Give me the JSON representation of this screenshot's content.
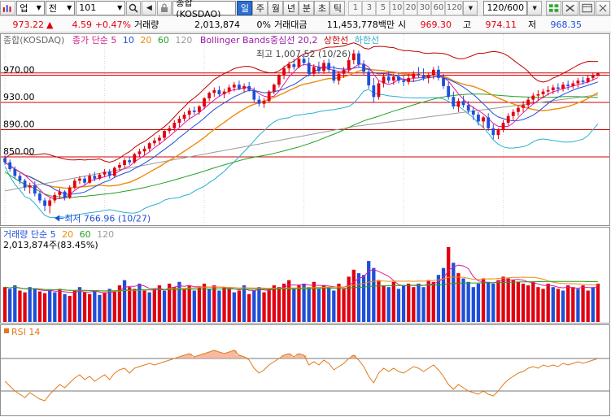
{
  "toolbar": {
    "market": "업",
    "stock_type": "전",
    "code": "101",
    "name": "종합(KOSDAQ)",
    "periods": [
      "일",
      "주",
      "월",
      "년",
      "분",
      "초",
      "틱"
    ],
    "active_period": "일",
    "intervals": [
      "1",
      "3",
      "5",
      "10",
      "20",
      "30",
      "60",
      "120"
    ],
    "count": "120/600"
  },
  "quote": {
    "price": "973.22",
    "arrow": "▲",
    "change": "4.59",
    "change_pct": "+0.47%",
    "volume_label": "거래량",
    "volume": "2,013,874",
    "volume_pct": "0%",
    "amount_label": "거래대금",
    "amount": "11,453,778백만",
    "open_label": "시",
    "open": "969.30",
    "high_label": "고",
    "high": "974.11",
    "low_label": "저",
    "low": "968.35"
  },
  "legend": {
    "name": "종합(KOSDAQ)",
    "ma_label": "종가 단순 5",
    "ma_periods": [
      "10",
      "20",
      "60",
      "120"
    ],
    "bb_label": "Bollinger Bands중심선 20,2",
    "bb_upper": "상한선",
    "bb_lower": "하한선",
    "volume_label": "거래량 단순 5",
    "volume_periods": [
      "20",
      "60",
      "120"
    ],
    "volume_value": "2,013,874주(83.45%)",
    "rsi_label": "RSI 14"
  },
  "colors": {
    "up": "#e0000f",
    "down": "#1f4fd8",
    "ma5": "#e01a9a",
    "ma10": "#1e4fd8",
    "ma20": "#f08a0a",
    "ma60": "#22a022",
    "ma120": "#9a9a9a",
    "bb_upper": "#c00000",
    "bb_lower": "#29b0d0",
    "rsi": "#e07a1a",
    "hline": "#d00000"
  },
  "chart_data": {
    "type": "candlestick",
    "ylim": [
      752,
      1010
    ],
    "y_ticks": [
      "970.00",
      "930.00",
      "890.00",
      "850.00"
    ],
    "y_tick_values": [
      970,
      930,
      890,
      850
    ],
    "hlines": [
      970,
      930,
      890,
      850
    ],
    "annotations": {
      "high": "최고 1,007.52 (10/26)",
      "low": "최저 766.96 (10/27)",
      "high_value": 1007.52,
      "low_value": 766.96
    },
    "candles": [
      [
        848,
        852,
        838,
        842
      ],
      [
        842,
        846,
        828,
        832
      ],
      [
        832,
        836,
        818,
        822
      ],
      [
        822,
        826,
        810,
        815
      ],
      [
        815,
        818,
        800,
        805
      ],
      [
        805,
        812,
        796,
        808
      ],
      [
        808,
        814,
        792,
        796
      ],
      [
        796,
        800,
        782,
        786
      ],
      [
        786,
        790,
        770,
        778
      ],
      [
        778,
        790,
        766.96,
        786
      ],
      [
        786,
        798,
        782,
        794
      ],
      [
        794,
        804,
        788,
        799
      ],
      [
        799,
        801,
        786,
        790
      ],
      [
        790,
        808,
        788,
        805
      ],
      [
        805,
        818,
        802,
        815
      ],
      [
        815,
        822,
        810,
        818
      ],
      [
        818,
        822,
        808,
        812
      ],
      [
        812,
        826,
        810,
        822
      ],
      [
        822,
        828,
        814,
        818
      ],
      [
        818,
        826,
        816,
        824
      ],
      [
        824,
        832,
        820,
        828
      ],
      [
        828,
        832,
        818,
        822
      ],
      [
        822,
        836,
        820,
        834
      ],
      [
        834,
        842,
        830,
        838
      ],
      [
        838,
        848,
        834,
        845
      ],
      [
        845,
        850,
        838,
        842
      ],
      [
        842,
        856,
        840,
        854
      ],
      [
        854,
        862,
        850,
        858
      ],
      [
        858,
        866,
        852,
        862
      ],
      [
        862,
        872,
        858,
        870
      ],
      [
        870,
        878,
        866,
        874
      ],
      [
        874,
        882,
        868,
        878
      ],
      [
        878,
        890,
        874,
        888
      ],
      [
        888,
        896,
        884,
        892
      ],
      [
        892,
        904,
        888,
        900
      ],
      [
        900,
        910,
        894,
        906
      ],
      [
        906,
        916,
        902,
        912
      ],
      [
        912,
        922,
        906,
        918
      ],
      [
        918,
        924,
        912,
        916
      ],
      [
        916,
        926,
        912,
        924
      ],
      [
        924,
        938,
        920,
        936
      ],
      [
        936,
        946,
        932,
        944
      ],
      [
        944,
        952,
        938,
        948
      ],
      [
        948,
        954,
        938,
        942
      ],
      [
        942,
        950,
        936,
        946
      ],
      [
        946,
        956,
        942,
        952
      ],
      [
        952,
        960,
        946,
        956
      ],
      [
        956,
        962,
        948,
        950
      ],
      [
        950,
        958,
        944,
        954
      ],
      [
        954,
        960,
        946,
        948
      ],
      [
        948,
        952,
        930,
        934
      ],
      [
        934,
        940,
        924,
        928
      ],
      [
        928,
        936,
        922,
        932
      ],
      [
        932,
        948,
        930,
        946
      ],
      [
        946,
        958,
        942,
        956
      ],
      [
        956,
        972,
        952,
        970
      ],
      [
        970,
        984,
        964,
        980
      ],
      [
        980,
        990,
        974,
        986
      ],
      [
        986,
        994,
        978,
        982
      ],
      [
        982,
        998,
        980,
        994
      ],
      [
        994,
        1000,
        984,
        988
      ],
      [
        988,
        996,
        968,
        972
      ],
      [
        972,
        986,
        968,
        982
      ],
      [
        982,
        990,
        972,
        976
      ],
      [
        976,
        992,
        972,
        988
      ],
      [
        988,
        994,
        974,
        978
      ],
      [
        978,
        984,
        958,
        962
      ],
      [
        962,
        976,
        956,
        972
      ],
      [
        972,
        982,
        966,
        978
      ],
      [
        978,
        996,
        974,
        992
      ],
      [
        992,
        1007.52,
        986,
        1002
      ],
      [
        1002,
        1006,
        982,
        986
      ],
      [
        986,
        992,
        970,
        975
      ],
      [
        975,
        980,
        950,
        955
      ],
      [
        955,
        966,
        930,
        938
      ],
      [
        938,
        962,
        934,
        958
      ],
      [
        958,
        972,
        952,
        968
      ],
      [
        968,
        976,
        958,
        962
      ],
      [
        962,
        972,
        956,
        968
      ],
      [
        968,
        974,
        958,
        962
      ],
      [
        962,
        970,
        954,
        960
      ],
      [
        960,
        972,
        956,
        966
      ],
      [
        966,
        976,
        960,
        972
      ],
      [
        972,
        982,
        966,
        970
      ],
      [
        970,
        980,
        962,
        966
      ],
      [
        966,
        974,
        958,
        970
      ],
      [
        970,
        982,
        964,
        978
      ],
      [
        978,
        984,
        962,
        966
      ],
      [
        966,
        972,
        950,
        954
      ],
      [
        954,
        960,
        934,
        938
      ],
      [
        938,
        946,
        920,
        924
      ],
      [
        924,
        936,
        916,
        932
      ],
      [
        932,
        940,
        922,
        926
      ],
      [
        926,
        932,
        914,
        918
      ],
      [
        918,
        924,
        904,
        912
      ],
      [
        912,
        916,
        896,
        902
      ],
      [
        902,
        910,
        892,
        908
      ],
      [
        908,
        914,
        888,
        892
      ],
      [
        892,
        898,
        876,
        882
      ],
      [
        882,
        892,
        876,
        890
      ],
      [
        890,
        904,
        886,
        900
      ],
      [
        900,
        914,
        896,
        910
      ],
      [
        910,
        920,
        904,
        916
      ],
      [
        916,
        926,
        910,
        922
      ],
      [
        922,
        932,
        916,
        926
      ],
      [
        926,
        938,
        922,
        934
      ],
      [
        934,
        944,
        928,
        940
      ],
      [
        940,
        948,
        932,
        942
      ],
      [
        942,
        950,
        936,
        946
      ],
      [
        946,
        954,
        940,
        948
      ],
      [
        948,
        956,
        942,
        952
      ],
      [
        952,
        958,
        944,
        950
      ],
      [
        950,
        960,
        946,
        956
      ],
      [
        956,
        962,
        948,
        954
      ],
      [
        954,
        962,
        950,
        958
      ],
      [
        958,
        966,
        952,
        962
      ],
      [
        962,
        968,
        956,
        960
      ],
      [
        960,
        970,
        958,
        966
      ],
      [
        966,
        974,
        962,
        970
      ],
      [
        968.63,
        974.11,
        968.35,
        973.22
      ]
    ],
    "volume_ylim": [
      0,
      100
    ],
    "volumes": [
      [
        40,
        1
      ],
      [
        38,
        0
      ],
      [
        42,
        0
      ],
      [
        36,
        1
      ],
      [
        34,
        1
      ],
      [
        40,
        0
      ],
      [
        38,
        0
      ],
      [
        35,
        1
      ],
      [
        33,
        1
      ],
      [
        36,
        0
      ],
      [
        34,
        0
      ],
      [
        38,
        1
      ],
      [
        32,
        0
      ],
      [
        30,
        1
      ],
      [
        36,
        1
      ],
      [
        40,
        0
      ],
      [
        34,
        1
      ],
      [
        32,
        1
      ],
      [
        35,
        0
      ],
      [
        31,
        0
      ],
      [
        34,
        1
      ],
      [
        38,
        0
      ],
      [
        36,
        1
      ],
      [
        42,
        1
      ],
      [
        48,
        0
      ],
      [
        40,
        1
      ],
      [
        38,
        1
      ],
      [
        44,
        0
      ],
      [
        36,
        1
      ],
      [
        34,
        0
      ],
      [
        38,
        1
      ],
      [
        42,
        1
      ],
      [
        36,
        0
      ],
      [
        44,
        1
      ],
      [
        40,
        1
      ],
      [
        46,
        0
      ],
      [
        38,
        1
      ],
      [
        42,
        1
      ],
      [
        36,
        0
      ],
      [
        40,
        1
      ],
      [
        44,
        1
      ],
      [
        38,
        0
      ],
      [
        42,
        1
      ],
      [
        36,
        0
      ],
      [
        40,
        1
      ],
      [
        38,
        1
      ],
      [
        34,
        0
      ],
      [
        36,
        1
      ],
      [
        42,
        0
      ],
      [
        32,
        1
      ],
      [
        36,
        0
      ],
      [
        40,
        0
      ],
      [
        34,
        1
      ],
      [
        38,
        1
      ],
      [
        42,
        1
      ],
      [
        40,
        1
      ],
      [
        44,
        1
      ],
      [
        48,
        1
      ],
      [
        38,
        0
      ],
      [
        42,
        1
      ],
      [
        44,
        0
      ],
      [
        40,
        0
      ],
      [
        46,
        1
      ],
      [
        38,
        0
      ],
      [
        42,
        1
      ],
      [
        40,
        0
      ],
      [
        36,
        0
      ],
      [
        44,
        1
      ],
      [
        38,
        1
      ],
      [
        52,
        1
      ],
      [
        60,
        1
      ],
      [
        56,
        0
      ],
      [
        54,
        0
      ],
      [
        70,
        0
      ],
      [
        62,
        0
      ],
      [
        48,
        1
      ],
      [
        42,
        1
      ],
      [
        40,
        0
      ],
      [
        46,
        1
      ],
      [
        38,
        0
      ],
      [
        42,
        0
      ],
      [
        44,
        1
      ],
      [
        40,
        1
      ],
      [
        44,
        0
      ],
      [
        40,
        0
      ],
      [
        48,
        1
      ],
      [
        46,
        1
      ],
      [
        54,
        0
      ],
      [
        62,
        0
      ],
      [
        86,
        1
      ],
      [
        68,
        0
      ],
      [
        56,
        1
      ],
      [
        50,
        0
      ],
      [
        46,
        0
      ],
      [
        40,
        0
      ],
      [
        44,
        0
      ],
      [
        50,
        1
      ],
      [
        46,
        0
      ],
      [
        44,
        0
      ],
      [
        48,
        1
      ],
      [
        52,
        1
      ],
      [
        50,
        1
      ],
      [
        48,
        1
      ],
      [
        46,
        1
      ],
      [
        44,
        1
      ],
      [
        42,
        1
      ],
      [
        46,
        1
      ],
      [
        40,
        1
      ],
      [
        38,
        1
      ],
      [
        44,
        1
      ],
      [
        40,
        0
      ],
      [
        38,
        1
      ],
      [
        36,
        0
      ],
      [
        42,
        1
      ],
      [
        40,
        1
      ],
      [
        38,
        0
      ],
      [
        42,
        1
      ],
      [
        36,
        1
      ],
      [
        40,
        0
      ],
      [
        44,
        1
      ]
    ],
    "rsi_ylim": [
      0,
      100
    ],
    "rsi_upper": 70,
    "rsi_lower": 30,
    "rsi": [
      42,
      36,
      30,
      26,
      22,
      28,
      24,
      20,
      18,
      26,
      32,
      38,
      34,
      40,
      46,
      50,
      44,
      48,
      42,
      46,
      50,
      44,
      52,
      56,
      58,
      52,
      58,
      60,
      62,
      64,
      62,
      64,
      66,
      68,
      70,
      72,
      74,
      76,
      72,
      74,
      76,
      78,
      80,
      78,
      76,
      78,
      80,
      74,
      72,
      68,
      58,
      52,
      56,
      62,
      66,
      70,
      74,
      76,
      72,
      76,
      74,
      62,
      66,
      62,
      68,
      64,
      56,
      60,
      64,
      70,
      74,
      68,
      60,
      48,
      40,
      52,
      58,
      54,
      58,
      54,
      52,
      56,
      60,
      58,
      54,
      58,
      62,
      56,
      48,
      38,
      32,
      38,
      34,
      30,
      28,
      26,
      30,
      26,
      24,
      30,
      38,
      44,
      48,
      52,
      54,
      58,
      60,
      58,
      62,
      60,
      62,
      60,
      64,
      62,
      64,
      66,
      64,
      66,
      68,
      70
    ]
  }
}
